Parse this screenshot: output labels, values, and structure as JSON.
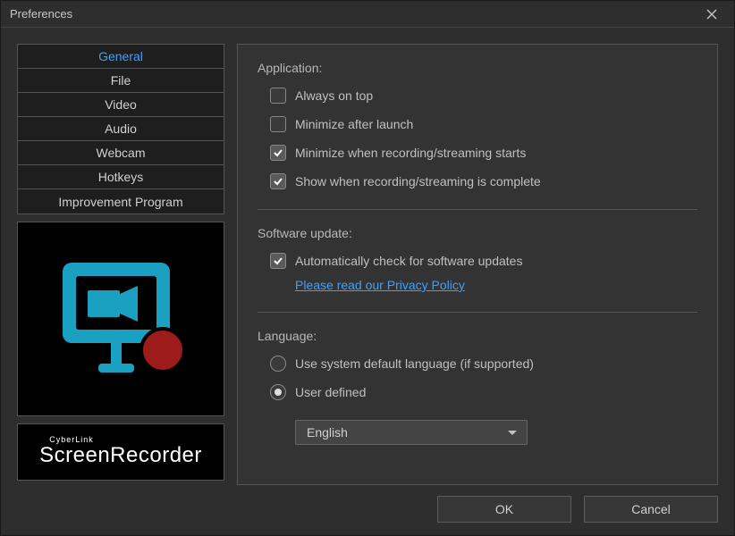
{
  "window": {
    "title": "Preferences"
  },
  "sidebar": {
    "tabs": [
      {
        "label": "General",
        "active": true
      },
      {
        "label": "File",
        "active": false
      },
      {
        "label": "Video",
        "active": false
      },
      {
        "label": "Audio",
        "active": false
      },
      {
        "label": "Webcam",
        "active": false
      },
      {
        "label": "Hotkeys",
        "active": false
      },
      {
        "label": "Improvement Program",
        "active": false
      }
    ],
    "brand_top": "CyberLink",
    "brand_main": "ScreenRecorder"
  },
  "sections": {
    "application": {
      "title": "Application:",
      "options": [
        {
          "label": "Always on top",
          "checked": false
        },
        {
          "label": "Minimize after launch",
          "checked": false
        },
        {
          "label": "Minimize when recording/streaming starts",
          "checked": true
        },
        {
          "label": "Show when recording/streaming is complete",
          "checked": true
        }
      ]
    },
    "update": {
      "title": "Software update:",
      "option": {
        "label": "Automatically check for software updates",
        "checked": true
      },
      "link": "Please read our Privacy Policy"
    },
    "language": {
      "title": "Language:",
      "radios": [
        {
          "label": "Use system default language (if supported)",
          "checked": false
        },
        {
          "label": "User defined",
          "checked": true
        }
      ],
      "selected": "English"
    }
  },
  "buttons": {
    "ok": "OK",
    "cancel": "Cancel"
  }
}
